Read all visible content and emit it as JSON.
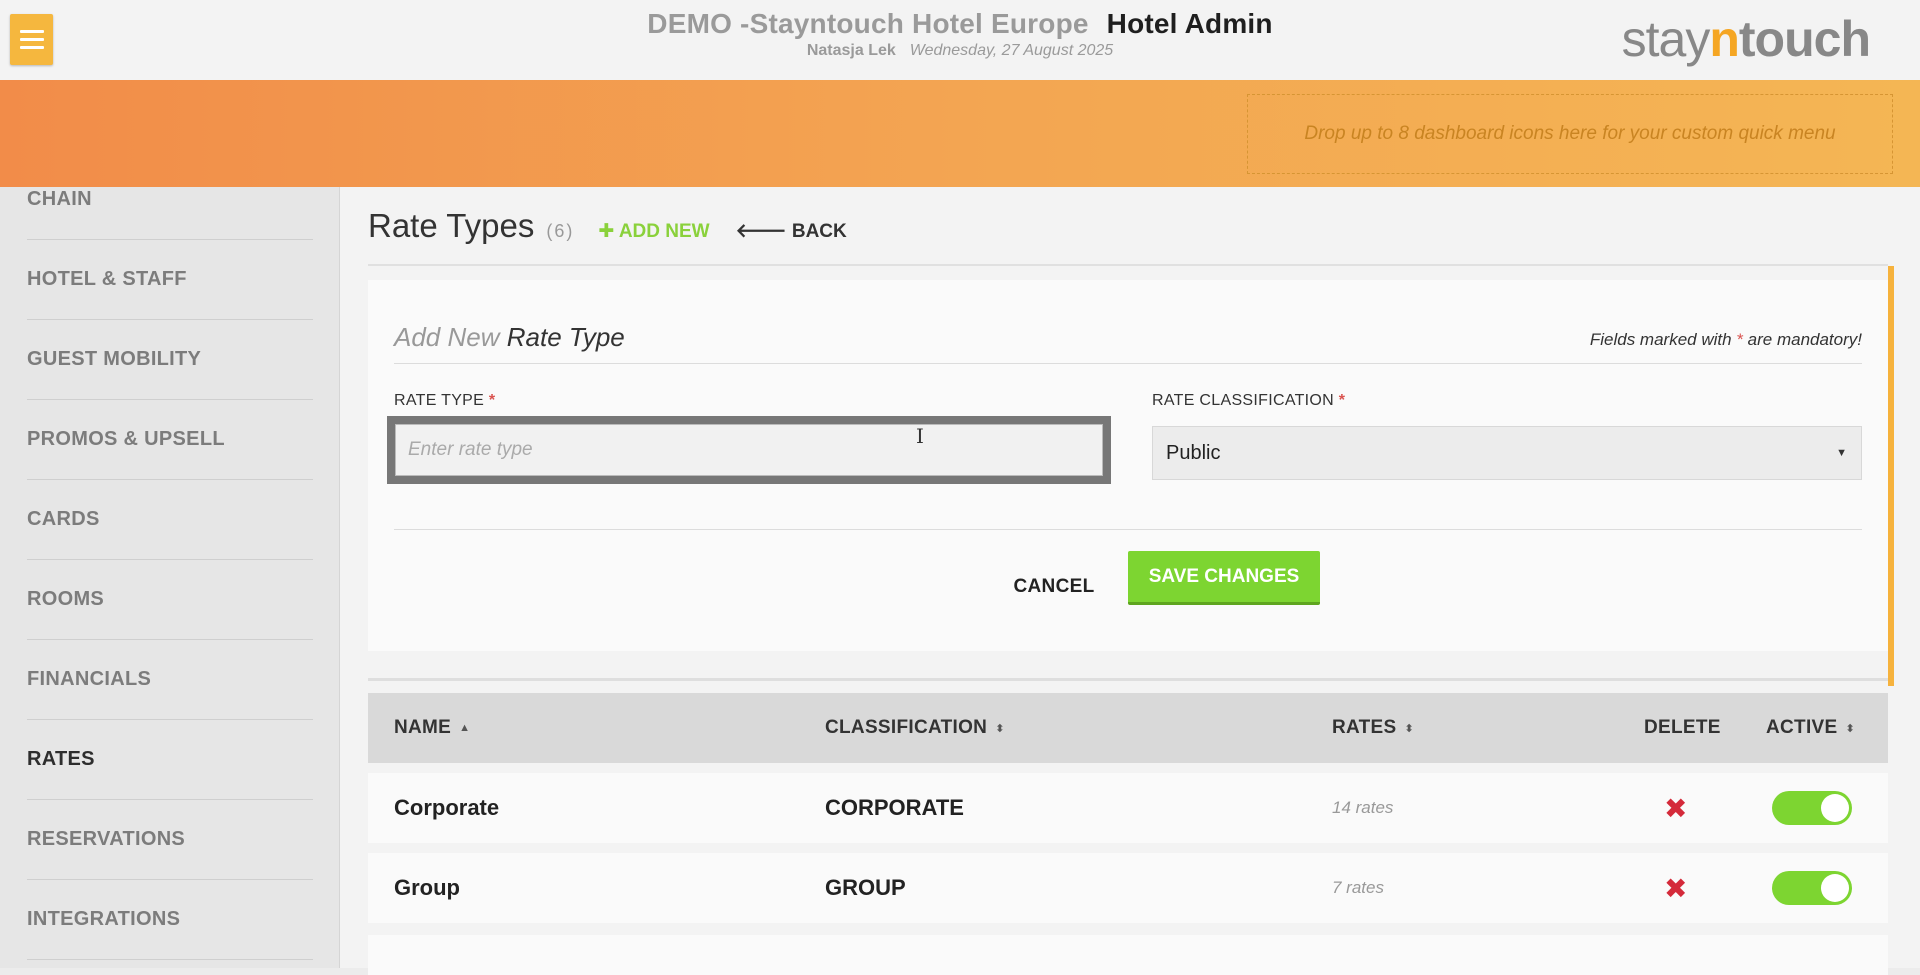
{
  "topbar": {
    "property_name": "DEMO -Stayntouch Hotel Europe",
    "app_name": "Hotel Admin",
    "user_name": "Natasja Lek",
    "date": "Wednesday, 27 August 2025",
    "logo_pre": "stay",
    "logo_n": "n",
    "logo_post": "touch"
  },
  "banner": {
    "dropzone_text": "Drop up to 8 dashboard icons here for your custom quick menu"
  },
  "sidebar": {
    "items": [
      {
        "label": "CHAIN"
      },
      {
        "label": "HOTEL & STAFF"
      },
      {
        "label": "GUEST MOBILITY"
      },
      {
        "label": "PROMOS & UPSELL"
      },
      {
        "label": "CARDS"
      },
      {
        "label": "ROOMS"
      },
      {
        "label": "FINANCIALS"
      },
      {
        "label": "RATES"
      },
      {
        "label": "RESERVATIONS"
      },
      {
        "label": "INTEGRATIONS"
      }
    ],
    "active": "RATES"
  },
  "page": {
    "title": "Rate Types",
    "count": "(6)",
    "add_new": "ADD NEW",
    "back": "BACK"
  },
  "form": {
    "title_prefix": "Add New",
    "title_main": "Rate Type",
    "mandatory_pre": "Fields marked with",
    "mandatory_star": "*",
    "mandatory_post": "are mandatory!",
    "rate_type_label": "RATE TYPE",
    "rate_type_placeholder": "Enter rate type",
    "rate_type_value": "",
    "classification_label": "RATE CLASSIFICATION",
    "classification_value": "Public",
    "required_star": "*",
    "cancel": "CANCEL",
    "save": "SAVE CHANGES"
  },
  "table": {
    "columns": {
      "name": "NAME",
      "classification": "CLASSIFICATION",
      "rates": "RATES",
      "delete": "DELETE",
      "active": "ACTIVE"
    },
    "rows": [
      {
        "name": "Corporate",
        "classification": "CORPORATE",
        "rates": "14 rates",
        "active": true
      },
      {
        "name": "Group",
        "classification": "GROUP",
        "rates": "7 rates",
        "active": true
      }
    ]
  },
  "colors": {
    "accent_orange": "#f5b73e",
    "save_green": "#7dd531",
    "delete_red": "#d42a3a"
  }
}
